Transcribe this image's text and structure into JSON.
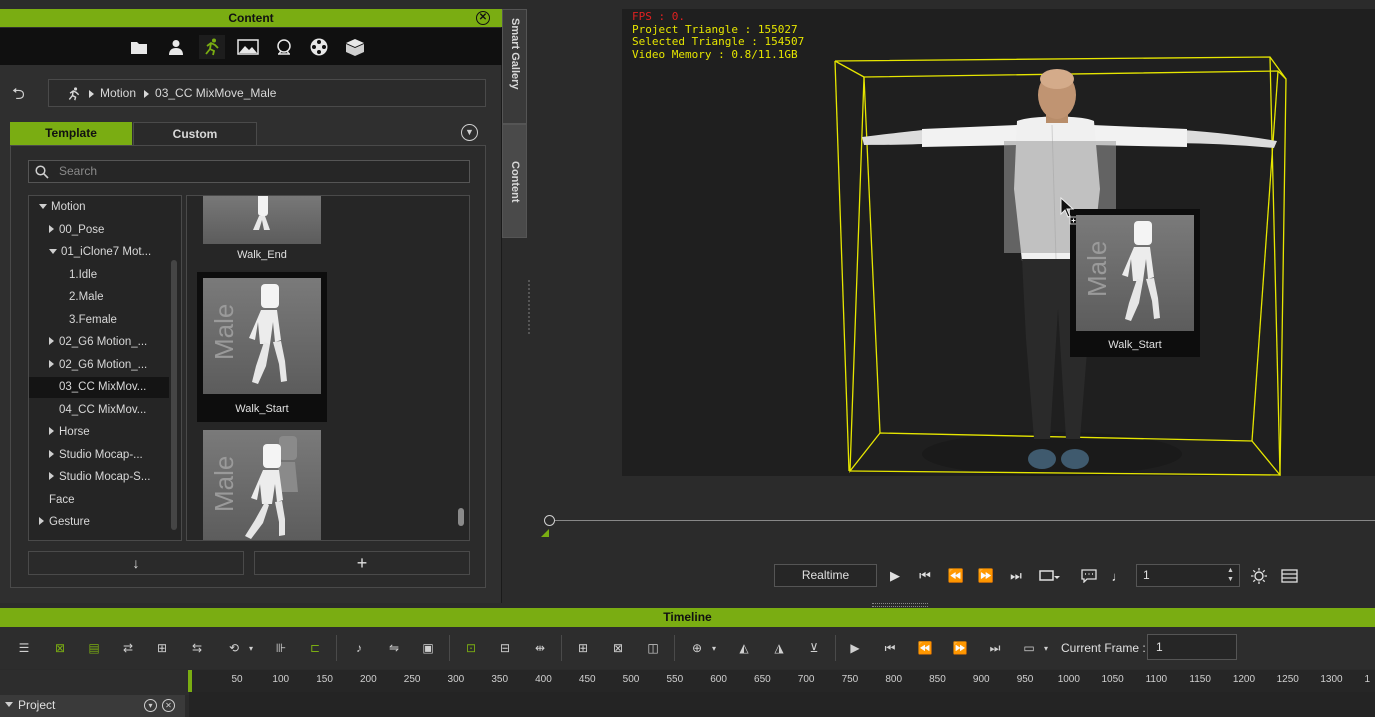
{
  "content_panel": {
    "title": "Content",
    "close_icon": "✕",
    "breadcrumb": {
      "items": [
        "Motion",
        "03_CC MixMove_Male"
      ]
    },
    "tabs": {
      "template": "Template",
      "custom": "Custom"
    },
    "search": {
      "placeholder": "Search"
    },
    "tree": [
      {
        "label": "Motion",
        "level": 0,
        "state": "expanded"
      },
      {
        "label": "00_Pose",
        "level": 1,
        "state": "collapsed"
      },
      {
        "label": "01_iClone7 Mot...",
        "level": 1,
        "state": "expanded"
      },
      {
        "label": "1.Idle",
        "level": 2,
        "state": "leaf"
      },
      {
        "label": "2.Male",
        "level": 2,
        "state": "leaf"
      },
      {
        "label": "3.Female",
        "level": 2,
        "state": "leaf"
      },
      {
        "label": "02_G6 Motion_...",
        "level": 1,
        "state": "collapsed"
      },
      {
        "label": "02_G6 Motion_...",
        "level": 1,
        "state": "collapsed"
      },
      {
        "label": "03_CC MixMov...",
        "level": 1,
        "state": "selected"
      },
      {
        "label": "04_CC MixMov...",
        "level": 1,
        "state": "leaf"
      },
      {
        "label": "Horse",
        "level": 1,
        "state": "collapsed"
      },
      {
        "label": "Studio Mocap-...",
        "level": 1,
        "state": "collapsed"
      },
      {
        "label": "Studio Mocap-S...",
        "level": 1,
        "state": "collapsed"
      },
      {
        "label": "Face",
        "level": 0,
        "state": "leaf"
      },
      {
        "label": "Gesture",
        "level": 0,
        "state": "collapsed"
      }
    ],
    "grid_items": [
      {
        "label": "Walk_End"
      },
      {
        "label": "Walk_Start",
        "selected": true
      },
      {
        "label": ""
      }
    ],
    "thumb_text": "Male",
    "buttons": {
      "down": "↓",
      "add": "+"
    }
  },
  "side_tabs": {
    "smart_gallery": "Smart Gallery",
    "content": "Content"
  },
  "viewport": {
    "stats": {
      "fps": "FPS : 0.",
      "project_triangle": "Project Triangle : 155027",
      "selected_triangle": "Selected Triangle : 154507",
      "video_memory": "Video Memory : 0.8/11.1GB"
    },
    "drag_preview": {
      "label": "Walk_Start",
      "thumb_text": "Male"
    }
  },
  "playback": {
    "realtime": "Realtime",
    "frame_value": "1",
    "icons": [
      "play-icon",
      "go-to-start-icon",
      "previous-frame-icon",
      "next-frame-icon",
      "go-to-end-icon",
      "loop-icon",
      "subtitle-icon",
      "music-note-icon"
    ]
  },
  "timeline": {
    "title": "Timeline",
    "current_frame_label": "Current Frame :",
    "current_frame_value": "1",
    "ruler_ticks": [
      "50",
      "100",
      "150",
      "200",
      "250",
      "300",
      "350",
      "400",
      "450",
      "500",
      "550",
      "600",
      "650",
      "700",
      "750",
      "800",
      "850",
      "900",
      "950",
      "1000",
      "1050",
      "1100",
      "1150",
      "1200",
      "1250",
      "1300",
      "1"
    ],
    "project_label": "Project"
  },
  "colors": {
    "accent": "#7aad12",
    "bounding_box": "#e6e600",
    "fps_red": "#e02020"
  }
}
